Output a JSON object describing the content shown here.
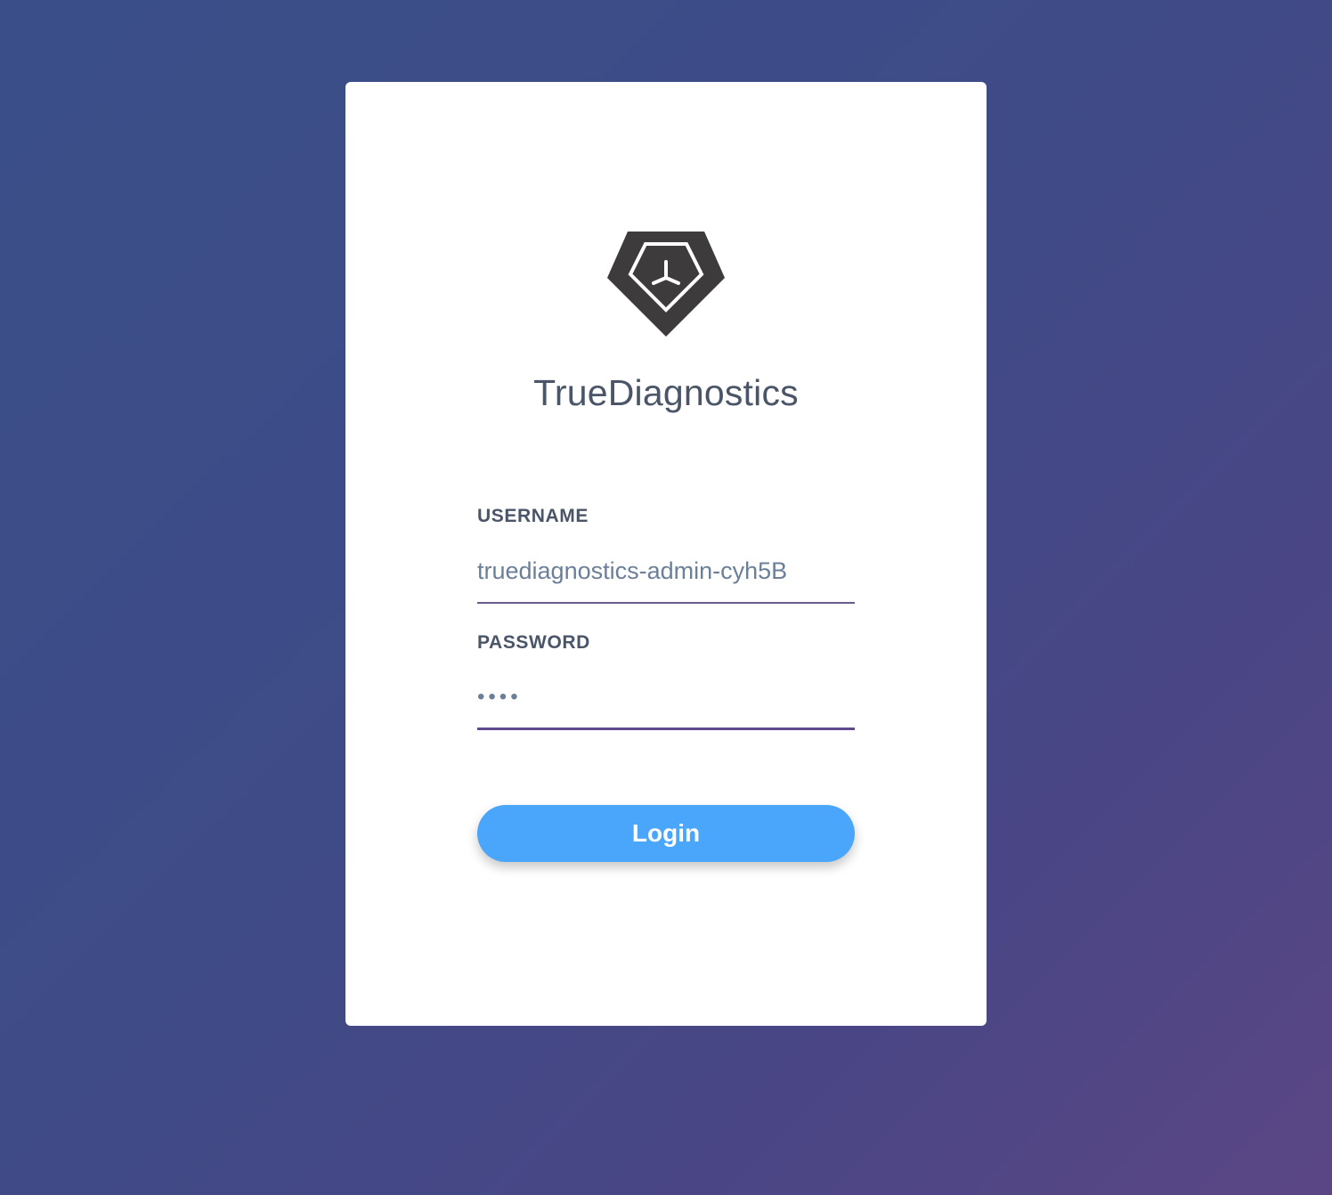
{
  "brand": {
    "name": "TrueDiagnostics",
    "logo_icon": "diamond-logo-icon"
  },
  "form": {
    "username_label": "USERNAME",
    "username_value": "truediagnostics-admin-cyh5B",
    "password_label": "PASSWORD",
    "password_value": "1234",
    "login_label": "Login"
  },
  "colors": {
    "background_start": "#3a4f89",
    "background_end": "#5b4685",
    "button": "#4aa6fb",
    "input_underline": "#5e4a8c",
    "text": "#4a5568"
  }
}
